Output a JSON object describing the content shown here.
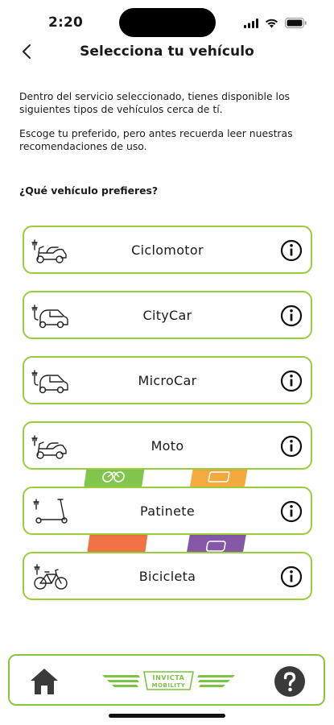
{
  "status_bar": {
    "time": "2:20",
    "icons": [
      "signal-icon",
      "wifi-icon",
      "battery-icon"
    ]
  },
  "header": {
    "back_icon": "chevron-left-icon",
    "title": "Selecciona tu vehículo"
  },
  "intro": {
    "paragraph_1": "Dentro del servicio seleccionado, tienes disponible los siguientes tipos de vehículos cerca de tí.",
    "paragraph_2": "Escoge tu preferido, pero antes recuerda leer nuestras recomendaciones de uso.",
    "question": "¿Qué vehículo prefieres?"
  },
  "vehicles": [
    {
      "label": "Ciclomotor",
      "icon": "electric-scooter-moped-icon"
    },
    {
      "label": "CityCar",
      "icon": "electric-car-icon"
    },
    {
      "label": "MicroCar",
      "icon": "electric-microcar-icon"
    },
    {
      "label": "Moto",
      "icon": "electric-motorbike-icon"
    },
    {
      "label": "Patinete",
      "icon": "electric-kick-scooter-icon"
    },
    {
      "label": "Bicicleta",
      "icon": "electric-bicycle-icon"
    }
  ],
  "bottom_bar": {
    "home_icon": "home-icon",
    "help_icon": "help-icon",
    "brand_line1": "INVICTA",
    "brand_line2": "MOBILITY"
  },
  "colors": {
    "accent_green": "#8bc53f",
    "card_border": "#9acd3c",
    "splash_green": "#7cc243",
    "splash_orange": "#f4a535",
    "splash_red": "#f06a3a",
    "splash_purple": "#7e4fa3"
  }
}
